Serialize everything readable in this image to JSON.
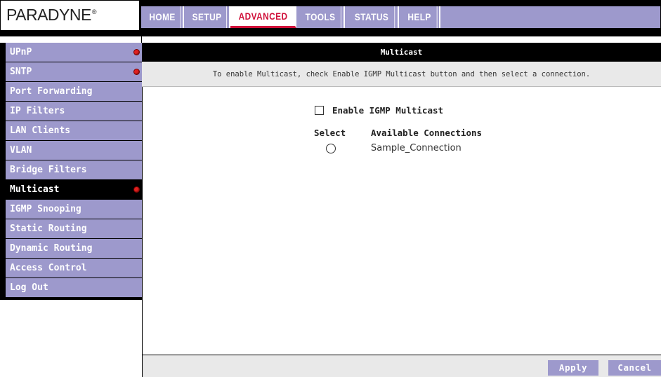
{
  "brand": {
    "logo": "PARADYNE",
    "trademark": "®"
  },
  "nav": {
    "tabs": [
      {
        "label": "HOME",
        "active": false
      },
      {
        "label": "SETUP",
        "active": false
      },
      {
        "label": "ADVANCED",
        "active": true
      },
      {
        "label": "TOOLS",
        "active": false
      },
      {
        "label": "STATUS",
        "active": false
      },
      {
        "label": "HELP",
        "active": false
      }
    ]
  },
  "sidebar": {
    "items": [
      {
        "label": "UPnP",
        "status_dot": true
      },
      {
        "label": "SNTP",
        "status_dot": true
      },
      {
        "label": "Port Forwarding",
        "status_dot": false
      },
      {
        "label": "IP Filters",
        "status_dot": false
      },
      {
        "label": "LAN Clients",
        "status_dot": false
      },
      {
        "label": "VLAN",
        "status_dot": false
      },
      {
        "label": "Bridge Filters",
        "status_dot": false
      },
      {
        "label": "Multicast",
        "status_dot": true,
        "active": true
      },
      {
        "label": "IGMP Snooping",
        "status_dot": false
      },
      {
        "label": "Static Routing",
        "status_dot": false
      },
      {
        "label": "Dynamic Routing",
        "status_dot": false
      },
      {
        "label": "Access Control",
        "status_dot": false
      },
      {
        "label": "Log Out",
        "status_dot": false
      }
    ]
  },
  "main": {
    "title": "Multicast",
    "description": "To enable Multicast, check Enable IGMP Multicast button and then select a connection.",
    "enable_label": "Enable IGMP Multicast",
    "enable_checked": false,
    "table": {
      "headers": [
        "Select",
        "Available Connections"
      ],
      "rows": [
        {
          "selected": false,
          "connection": "Sample_Connection"
        }
      ]
    }
  },
  "footer": {
    "apply_label": "Apply",
    "cancel_label": "Cancel"
  },
  "colors": {
    "accent": "#9d99cc",
    "active_tab_text": "#d0103a",
    "status_dot": "#e0201f"
  }
}
